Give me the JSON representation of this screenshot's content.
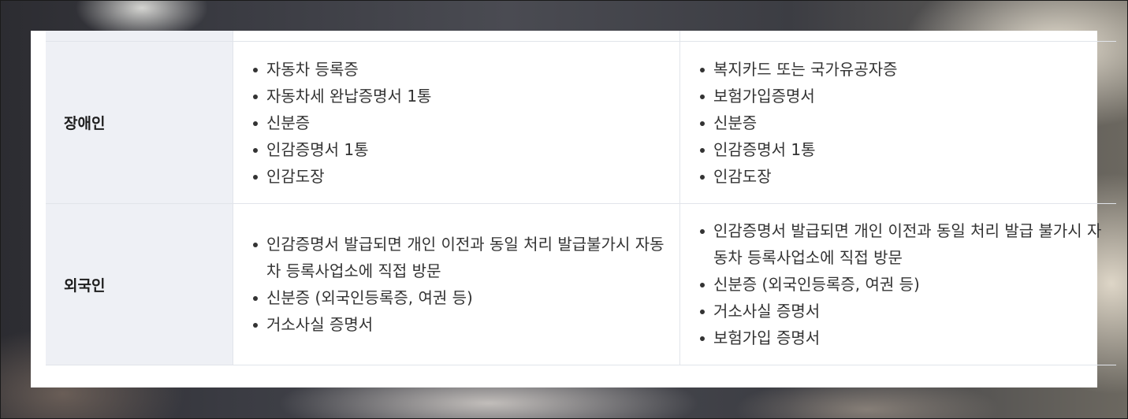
{
  "rows": [
    {
      "category": "장애인",
      "col1": [
        "자동차 등록증",
        "자동차세 완납증명서 1통",
        "신분증",
        "인감증명서 1통",
        "인감도장"
      ],
      "col2": [
        "복지카드 또는 국가유공자증",
        "보험가입증명서",
        "신분증",
        "인감증명서 1통",
        "인감도장"
      ]
    },
    {
      "category": "외국인",
      "col1": [
        "인감증명서 발급되면 개인 이전과 동일 처리 발급불가시 자동차 등록사업소에 직접 방문",
        "신분증 (외국인등록증, 여권 등)",
        "거소사실 증명서"
      ],
      "col2": [
        "인감증명서 발급되면 개인 이전과 동일 처리 발급 불가시 자동차 등록사업소에 직접 방문",
        "신분증 (외국인등록증, 여권 등)",
        "거소사실 증명서",
        "보험가입 증명서"
      ]
    }
  ]
}
